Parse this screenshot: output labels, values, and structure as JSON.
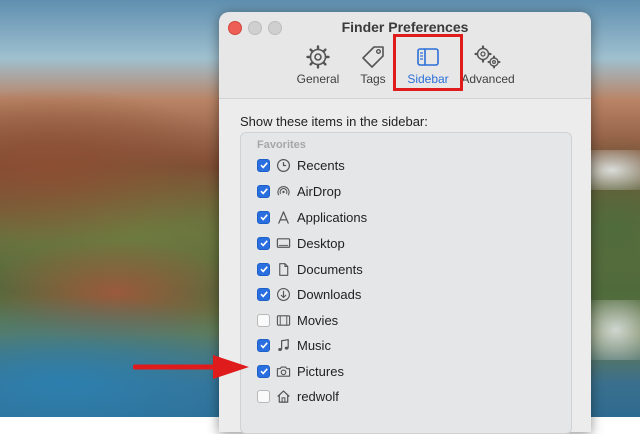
{
  "window": {
    "title": "Finder Preferences"
  },
  "toolbar": {
    "tabs": [
      {
        "label": "General",
        "icon": "gear-icon"
      },
      {
        "label": "Tags",
        "icon": "tag-icon"
      },
      {
        "label": "Sidebar",
        "icon": "sidebar-icon",
        "selected": true
      },
      {
        "label": "Advanced",
        "icon": "gears-icon"
      }
    ]
  },
  "sidebar_prefs": {
    "heading": "Show these items in the sidebar:",
    "group": "Favorites",
    "items": [
      {
        "label": "Recents",
        "checked": true,
        "icon": "clock-icon"
      },
      {
        "label": "AirDrop",
        "checked": true,
        "icon": "airdrop-icon"
      },
      {
        "label": "Applications",
        "checked": true,
        "icon": "applications-icon"
      },
      {
        "label": "Desktop",
        "checked": true,
        "icon": "desktop-icon"
      },
      {
        "label": "Documents",
        "checked": true,
        "icon": "document-icon"
      },
      {
        "label": "Downloads",
        "checked": true,
        "icon": "download-icon"
      },
      {
        "label": "Movies",
        "checked": false,
        "icon": "film-icon"
      },
      {
        "label": "Music",
        "checked": true,
        "icon": "music-note-icon"
      },
      {
        "label": "Pictures",
        "checked": true,
        "icon": "camera-icon"
      },
      {
        "label": "redwolf",
        "checked": false,
        "icon": "home-icon"
      }
    ]
  },
  "colors": {
    "accent": "#2a6fe0",
    "annotation": "#e01b1b"
  }
}
